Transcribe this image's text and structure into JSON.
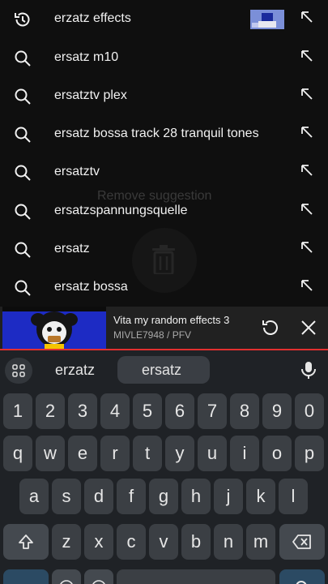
{
  "suggestions": [
    {
      "icon": "history-icon",
      "text": "erzatz effects",
      "has_thumb": true
    },
    {
      "icon": "search-icon",
      "text": "ersatz m10"
    },
    {
      "icon": "search-icon",
      "text": "ersatztv plex"
    },
    {
      "icon": "search-icon",
      "text": "ersatz bossa track 28 tranquil tones"
    },
    {
      "icon": "search-icon",
      "text": "ersatztv"
    },
    {
      "icon": "search-icon",
      "text": "ersatzspannungsquelle"
    },
    {
      "icon": "search-icon",
      "text": "ersatz"
    },
    {
      "icon": "search-icon",
      "text": "ersatz bossa"
    }
  ],
  "overlay": {
    "remove_label": "Remove suggestion"
  },
  "miniplayer": {
    "title": "Vita my random effects 3",
    "subtitle": "MIVLE7948 / PFV",
    "progress_color": "#e3302f"
  },
  "keyboard": {
    "suggestions": [
      "erzatz",
      "ersatz"
    ],
    "row_numbers": [
      "1",
      "2",
      "3",
      "4",
      "5",
      "6",
      "7",
      "8",
      "9",
      "0"
    ],
    "row_1": [
      "q",
      "w",
      "e",
      "r",
      "t",
      "y",
      "u",
      "i",
      "o",
      "p"
    ],
    "row_2": [
      "a",
      "s",
      "d",
      "f",
      "g",
      "h",
      "j",
      "k",
      "l"
    ],
    "row_3": [
      "z",
      "x",
      "c",
      "v",
      "b",
      "n",
      "m"
    ]
  }
}
